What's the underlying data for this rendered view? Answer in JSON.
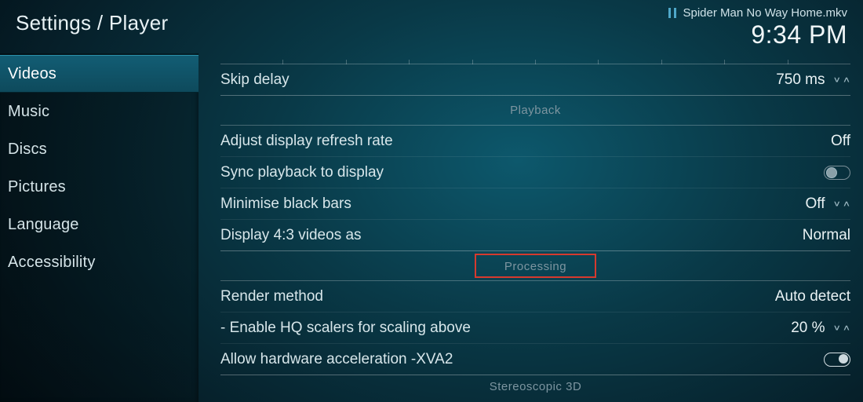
{
  "header": {
    "breadcrumb": "Settings / Player",
    "now_playing": "Spider Man No Way Home.mkv",
    "clock": "9:34 PM"
  },
  "sidebar": {
    "items": [
      {
        "label": "Videos",
        "active": true
      },
      {
        "label": "Music",
        "active": false
      },
      {
        "label": "Discs",
        "active": false
      },
      {
        "label": "Pictures",
        "active": false
      },
      {
        "label": "Language",
        "active": false
      },
      {
        "label": "Accessibility",
        "active": false
      }
    ]
  },
  "content": {
    "top_row": {
      "label": "Skip delay",
      "value": "750 ms"
    },
    "sections": [
      {
        "title": "Playback",
        "rows": [
          {
            "label": "Adjust display refresh rate",
            "value": "Off",
            "control": "text"
          },
          {
            "label": "Sync playback to display",
            "value": "",
            "control": "toggle-off"
          },
          {
            "label": "Minimise black bars",
            "value": "Off",
            "control": "spinner"
          },
          {
            "label": "Display 4:3 videos as",
            "value": "Normal",
            "control": "text"
          }
        ]
      },
      {
        "title": "Processing",
        "highlight": true,
        "rows": [
          {
            "label": "Render method",
            "value": "Auto detect",
            "control": "text"
          },
          {
            "label": "- Enable HQ scalers for scaling above",
            "value": "20 %",
            "control": "spinner"
          },
          {
            "label": "Allow hardware acceleration -XVA2",
            "value": "",
            "control": "toggle-on"
          }
        ]
      },
      {
        "title": "Stereoscopic 3D",
        "rows": []
      }
    ]
  }
}
